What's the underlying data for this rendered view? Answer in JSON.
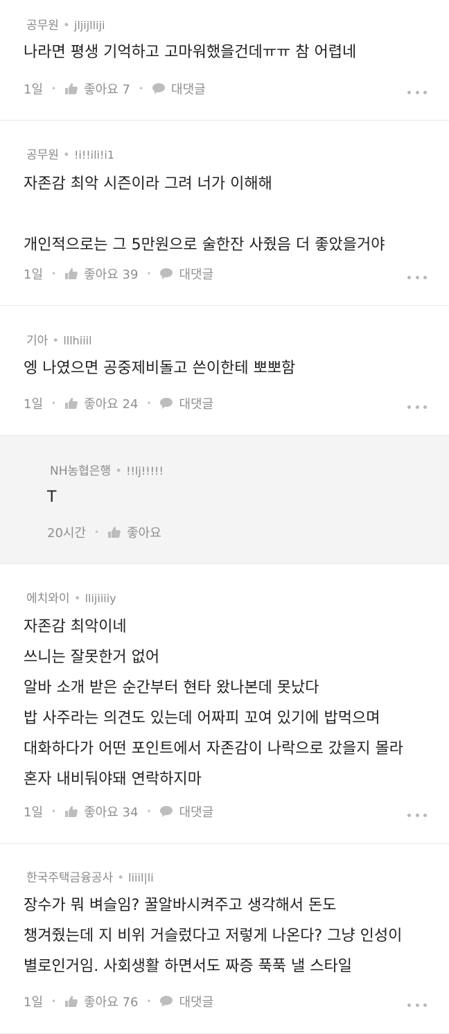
{
  "comments": [
    {
      "company": "공무원",
      "nickname": "jljijlliji",
      "text": "나라면 평생 기억하고 고마워했을건데ㅠㅠ 참 어렵네",
      "time": "1일",
      "like_label": "좋아요 7",
      "reply_label": "대댓글"
    },
    {
      "company": "공무원",
      "nickname": "!i!!ili!i1",
      "text": "자존감 최악 시즌이라 그려 너가 이해해\n\n개인적으로는 그 5만원으로 술한잔 사줬음 더 좋았을거야",
      "time": "1일",
      "like_label": "좋아요 39",
      "reply_label": "대댓글"
    },
    {
      "company": "기아",
      "nickname": "lllhiiil",
      "text": "엥 나였으면 공중제비돌고 쓴이한테 뽀뽀함",
      "time": "1일",
      "like_label": "좋아요 24",
      "reply_label": "대댓글"
    },
    {
      "company": "NH농협은행",
      "nickname": "!!lj!!!!!",
      "text": "T",
      "time": "20시간",
      "like_label": "좋아요"
    },
    {
      "company": "에치와이",
      "nickname": "llijiiiiy",
      "text": "자존감 최악이네\n쓰니는 잘못한거 없어\n알바 소개 받은 순간부터 현타 왔나본데 못났다\n밥 사주라는 의견도 있는데 어짜피 꼬여 있기에 밥먹으며\n대화하다가 어떤 포인트에서 자존감이 나락으로 갔을지 몰라\n혼자 내비둬야돼 연락하지마",
      "time": "1일",
      "like_label": "좋아요 34",
      "reply_label": "대댓글"
    },
    {
      "company": "한국주택금융공사",
      "nickname": "liiil|li",
      "text": "장수가 뭐 벼슬임? 꿀알바시켜주고 생각해서 돈도\n챙겨줬는데 지 비위 거슬렀다고 저렇게 나온다? 그냥 인성이\n별로인거임. 사회생활 하면서도 짜증 푹푹 낼 스타일",
      "time": "1일",
      "like_label": "좋아요 76",
      "reply_label": "대댓글"
    }
  ],
  "icons": {
    "like": "thumbs-up-icon",
    "reply": "speech-bubble-icon",
    "more": "more-dots-icon"
  },
  "colors": {
    "reply_background": "#f4f4f4",
    "meta_text": "#8f8f8f"
  }
}
